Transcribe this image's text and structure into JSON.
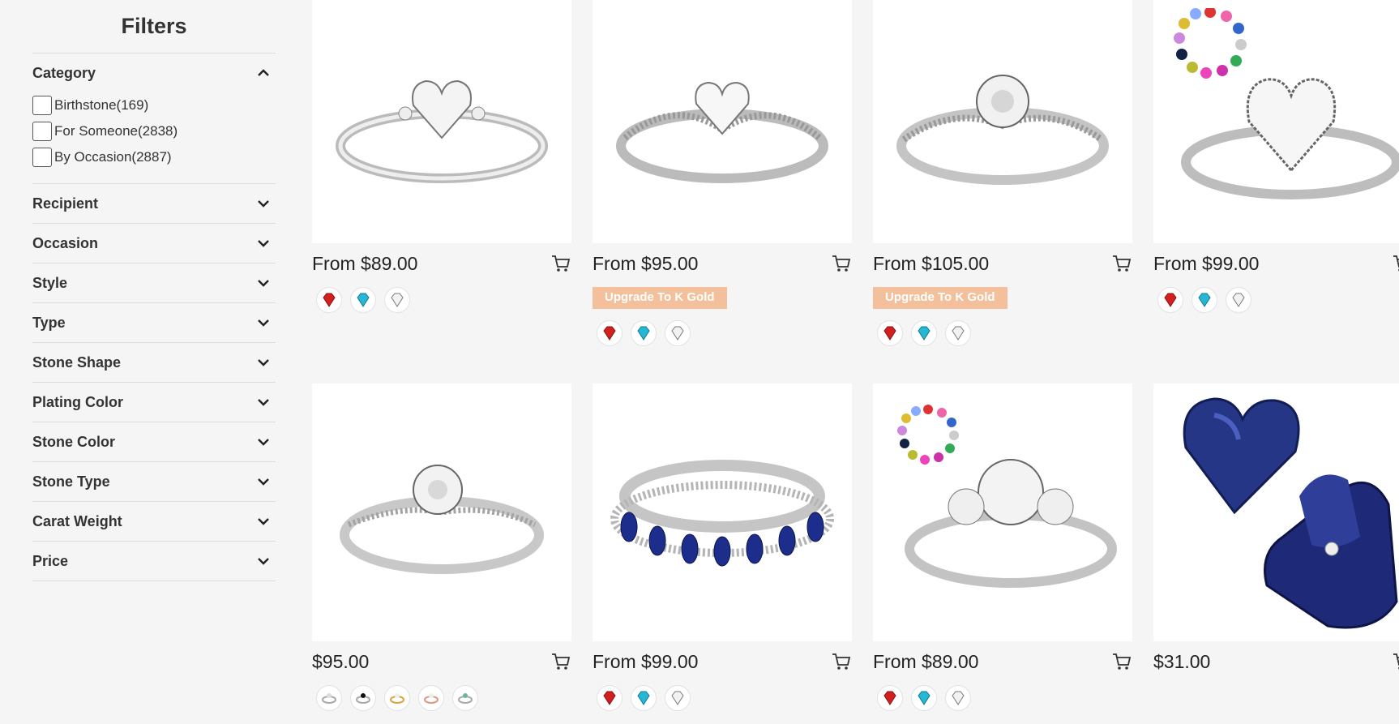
{
  "sidebar": {
    "title": "Filters",
    "sections": [
      {
        "label": "Category",
        "expanded": true,
        "options": [
          "Birthstone(169)",
          "For Someone(2838)",
          "By Occasion(2887)"
        ]
      },
      {
        "label": "Recipient"
      },
      {
        "label": "Occasion"
      },
      {
        "label": "Style"
      },
      {
        "label": "Type"
      },
      {
        "label": "Stone Shape"
      },
      {
        "label": "Plating Color"
      },
      {
        "label": "Stone Color"
      },
      {
        "label": "Stone Type"
      },
      {
        "label": "Carat Weight"
      },
      {
        "label": "Price"
      }
    ]
  },
  "products": [
    {
      "price": "From $89.00",
      "image_icon": "heart-ring-icon",
      "swatches": [
        "ruby-gem-icon",
        "aquamarine-gem-icon",
        "diamond-gem-icon"
      ]
    },
    {
      "price": "From $95.00",
      "image_icon": "heart-twist-ring-icon",
      "badge": "Upgrade To K Gold",
      "swatches": [
        "ruby-gem-icon",
        "aquamarine-gem-icon",
        "diamond-gem-icon"
      ]
    },
    {
      "price": "From $105.00",
      "image_icon": "round-twist-ring-icon",
      "badge": "Upgrade To K Gold",
      "swatches": [
        "ruby-gem-icon",
        "aquamarine-gem-icon",
        "diamond-gem-icon"
      ]
    },
    {
      "price": "From $99.00",
      "image_icon": "halo-heart-ring-icon",
      "swatches": [
        "ruby-gem-icon",
        "aquamarine-gem-icon",
        "diamond-gem-icon"
      ]
    },
    {
      "price": "$95.00",
      "image_icon": "solitaire-ring-icon",
      "swatches": [
        "silver-ring-swatch-icon",
        "black-ring-swatch-icon",
        "gold-ring-swatch-icon",
        "rose-gold-ring-swatch-icon",
        "green-ring-swatch-icon"
      ]
    },
    {
      "price": "From $99.00",
      "image_icon": "sapphire-band-icon",
      "swatches": [
        "ruby-gem-icon",
        "aquamarine-gem-icon",
        "diamond-gem-icon"
      ]
    },
    {
      "price": "From $89.00",
      "image_icon": "three-stone-ring-icon",
      "swatches": [
        "ruby-gem-icon",
        "aquamarine-gem-icon",
        "diamond-gem-icon"
      ]
    },
    {
      "price": "$31.00",
      "image_icon": "heart-ring-box-icon",
      "swatches": []
    }
  ],
  "colors": {
    "badge": "#f4c09b",
    "ruby": "#d21f1f",
    "aquamarine": "#25b7d3"
  }
}
